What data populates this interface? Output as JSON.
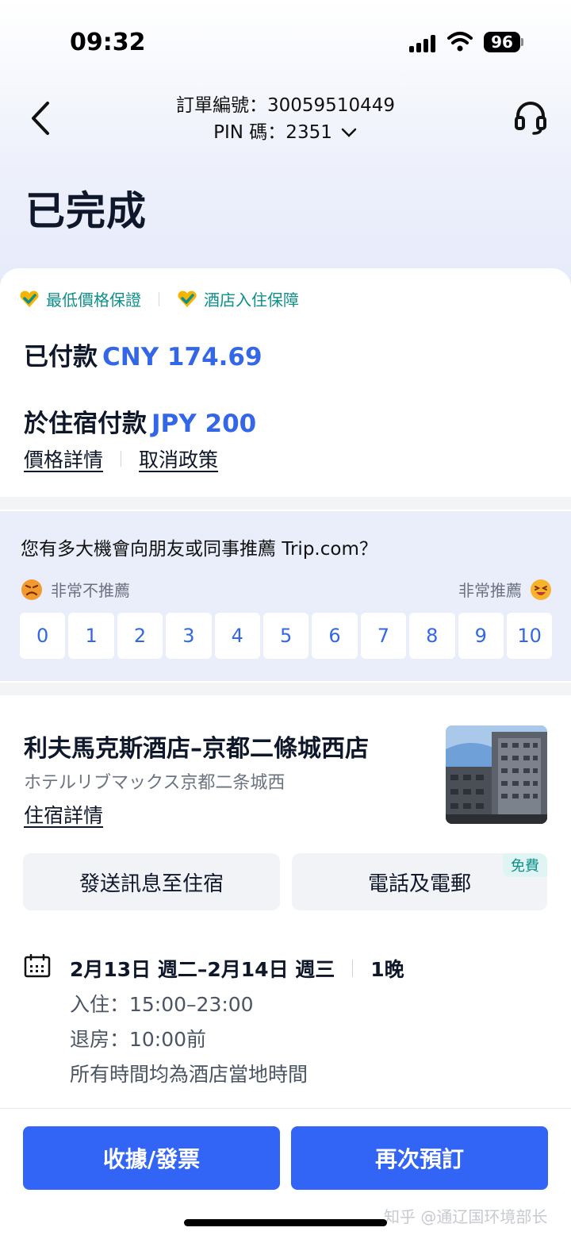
{
  "status_bar": {
    "time": "09:32",
    "battery": "96"
  },
  "header": {
    "order_number": "訂單編號：30059510449",
    "pin": "PIN 碼：2351",
    "title": "已完成"
  },
  "guarantees": [
    "最低價格保證",
    "酒店入住保障"
  ],
  "payment": {
    "paid_label": "已付款",
    "paid_amount": "CNY 174.69",
    "at_hotel_label": "於住宿付款",
    "at_hotel_amount": "JPY 200",
    "link_price": "價格詳情",
    "link_cancel": "取消政策"
  },
  "survey": {
    "question": "您有多大機會向朋友或同事推薦 Trip.com？",
    "low_label": "非常不推薦",
    "high_label": "非常推薦",
    "options": [
      "0",
      "1",
      "2",
      "3",
      "4",
      "5",
      "6",
      "7",
      "8",
      "9",
      "10"
    ]
  },
  "hotel": {
    "name": "利夫馬克斯酒店–京都二條城西店",
    "name_local": "ホテルリブマックス京都二条城西",
    "details_link": "住宿詳情",
    "message_button": "發送訊息至住宿",
    "contact_button": "電話及電郵",
    "free_badge": "免費"
  },
  "stay": {
    "dates": "2月13日 週二–2月14日 週三",
    "nights": "1晚",
    "checkin": "入住：15:00–23:00",
    "checkout": "退房：10:00前",
    "timezone_note": "所有時間均為酒店當地時間"
  },
  "bottom": {
    "receipt_button": "收據/發票",
    "rebook_button": "再次預訂"
  },
  "watermark": "知乎 @通辽国环境部长",
  "colors": {
    "accent": "#3264f5",
    "price": "#3367e8",
    "teal": "#0e8f8a"
  }
}
